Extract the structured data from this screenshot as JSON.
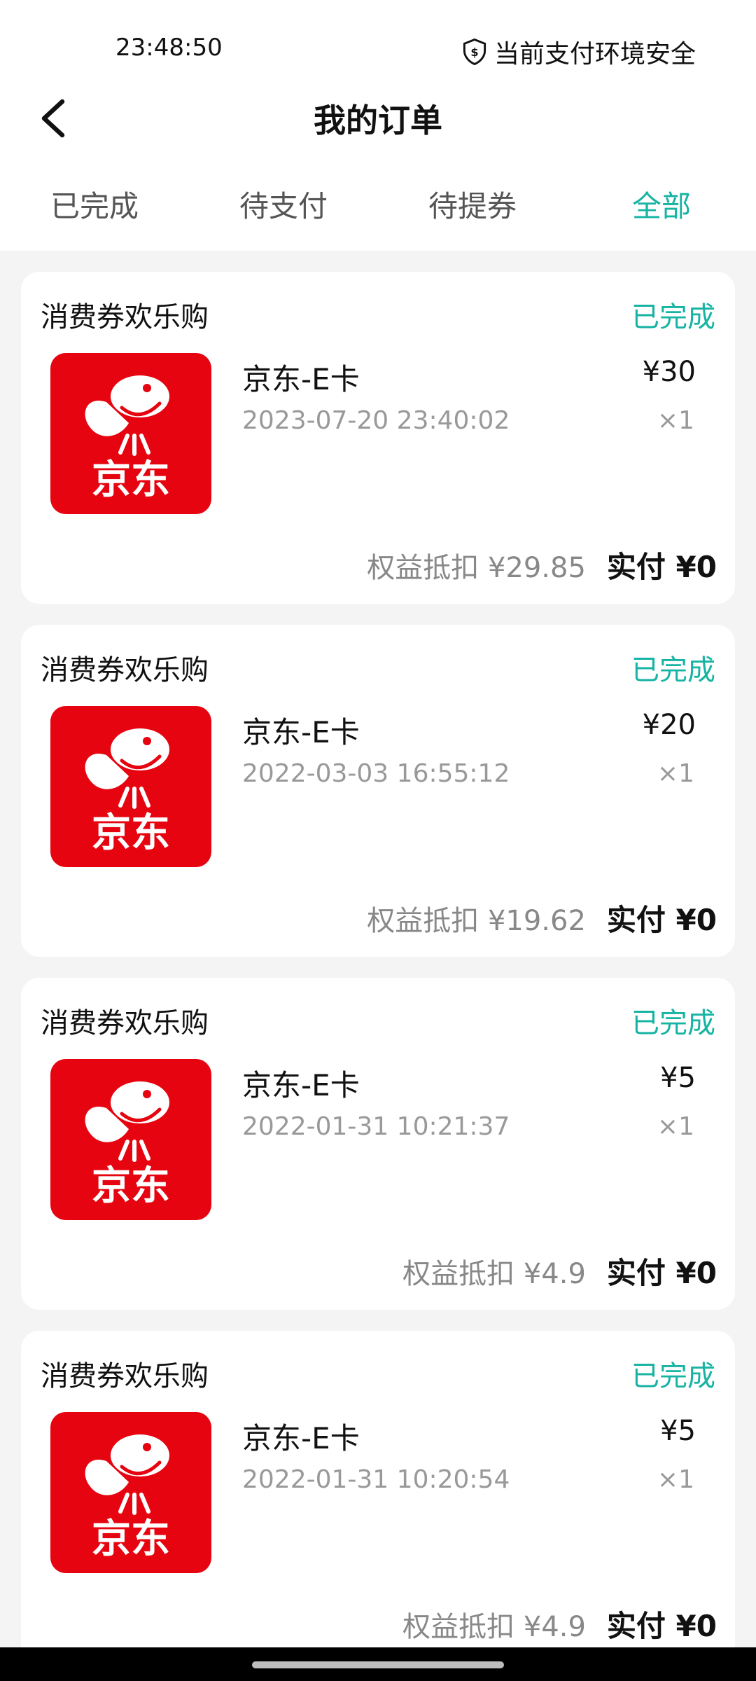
{
  "status_bar": {
    "time": "23:48:50",
    "security_text": "当前支付环境安全"
  },
  "nav": {
    "title": "我的订单"
  },
  "tabs": [
    {
      "label": "已完成"
    },
    {
      "label": "待支付"
    },
    {
      "label": "待提券"
    },
    {
      "label": "全部"
    }
  ],
  "active_tab": "全部",
  "colors": {
    "accent": "#17b3a3",
    "brand_red": "#e5040f"
  },
  "icons": [
    "back-arrow-icon",
    "shield-check-icon",
    "jd-logo-icon"
  ],
  "orders": [
    {
      "store": "消费券欢乐购",
      "status": "已完成",
      "product": "京东-E卡",
      "time": "2023-07-20 23:40:02",
      "price": "¥30",
      "qty": "×1",
      "discount": "权益抵扣 ¥29.85",
      "paid": "实付 ¥0",
      "logo_text": "京东"
    },
    {
      "store": "消费券欢乐购",
      "status": "已完成",
      "product": "京东-E卡",
      "time": "2022-03-03 16:55:12",
      "price": "¥20",
      "qty": "×1",
      "discount": "权益抵扣 ¥19.62",
      "paid": "实付 ¥0",
      "logo_text": "京东"
    },
    {
      "store": "消费券欢乐购",
      "status": "已完成",
      "product": "京东-E卡",
      "time": "2022-01-31 10:21:37",
      "price": "¥5",
      "qty": "×1",
      "discount": "权益抵扣 ¥4.9",
      "paid": "实付 ¥0",
      "logo_text": "京东"
    },
    {
      "store": "消费券欢乐购",
      "status": "已完成",
      "product": "京东-E卡",
      "time": "2022-01-31 10:20:54",
      "price": "¥5",
      "qty": "×1",
      "discount": "权益抵扣 ¥4.9",
      "paid": "实付 ¥0",
      "logo_text": "京东"
    }
  ]
}
